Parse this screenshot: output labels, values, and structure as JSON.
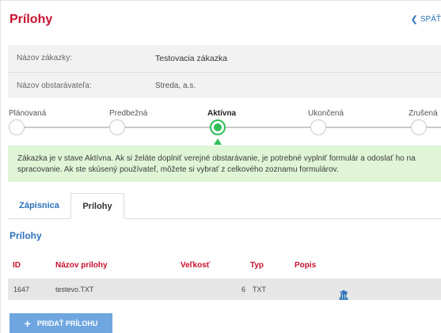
{
  "page": {
    "title": "Prílohy",
    "back_label": "SPÄŤ"
  },
  "info": {
    "rows": [
      {
        "label": "Názov zákazky:",
        "value": "Testovacia zákazka"
      },
      {
        "label": "Názov obstarávateľa:",
        "value": "Streda, a.s."
      }
    ]
  },
  "progress": {
    "steps": [
      {
        "label": "Plánovaná",
        "active": false
      },
      {
        "label": "Predbežná",
        "active": false
      },
      {
        "label": "Aktívna",
        "active": true
      },
      {
        "label": "Ukončená",
        "active": false
      },
      {
        "label": "Zrušená",
        "active": false
      }
    ],
    "accent_color": "#2fbf58"
  },
  "alert": {
    "text": "Zákazka je v stave Aktívna. Ak si želáte doplniť verejné obstarávanie, je potrebné vyplniť formulár a odoslať ho na spracovanie. Ak ste skúsený používateľ, môžete si vybrať z celkového zoznamu formulárov."
  },
  "tabs": [
    {
      "label": "Zápisnica",
      "active": false
    },
    {
      "label": "Prílohy",
      "active": true
    }
  ],
  "attachments": {
    "section_title": "Prílohy",
    "columns": [
      "ID",
      "Názov prílohy",
      "Veľkosť",
      "Typ",
      "Popis"
    ],
    "rows": [
      {
        "id": "1647",
        "name": "testevo.TXT",
        "size": "6",
        "type": "TXT",
        "description": ""
      }
    ],
    "row_icons": [
      "pencil-icon",
      "download-icon",
      "trash-icon"
    ]
  },
  "add_button": {
    "label": "PRIDAŤ PRÍLOHU",
    "icon": "plus-icon"
  },
  "colors": {
    "title_red": "#c8102e",
    "link_blue": "#2b72b9",
    "alert_bg": "#dff5d6",
    "button_blue": "#6fa6e0"
  }
}
